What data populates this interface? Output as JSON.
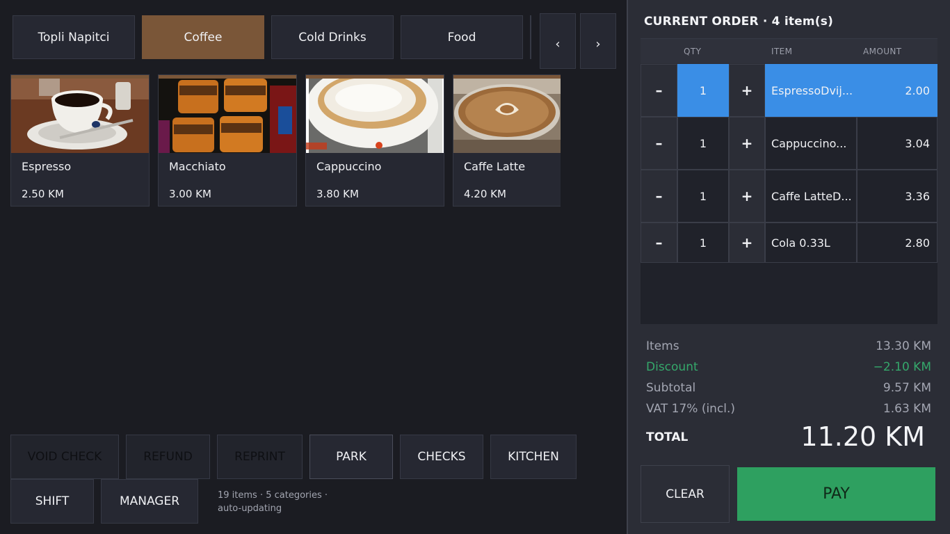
{
  "categories": [
    {
      "label": "Topli Napitci",
      "active": false
    },
    {
      "label": "Coffee",
      "active": true
    },
    {
      "label": "Cold Drinks",
      "active": false
    },
    {
      "label": "Food",
      "active": false
    }
  ],
  "nav": {
    "prev": "‹",
    "next": "›"
  },
  "products": [
    {
      "name": "Espresso",
      "price": "2.50 KM"
    },
    {
      "name": "Macchiato",
      "price": "3.00 KM"
    },
    {
      "name": "Cappuccino",
      "price": "3.80 KM"
    },
    {
      "name": "Caffe Latte",
      "price": "4.20 KM"
    }
  ],
  "actions": {
    "void_check": "VOID CHECK",
    "refund": "REFUND",
    "reprint": "REPRINT",
    "park": "PARK",
    "checks": "CHECKS",
    "kitchen": "KITCHEN",
    "shift": "SHIFT",
    "manager": "MANAGER"
  },
  "footnote": {
    "line1": "19 items · 5 categories ·",
    "line2": "auto-updating"
  },
  "order": {
    "title": "CURRENT ORDER · 4 item(s)",
    "headers": {
      "qty": "QTY",
      "item": "ITEM",
      "amount": "AMOUNT"
    },
    "minus": "–",
    "plus": "+",
    "rows": [
      {
        "qty": "1",
        "item": "EspressoDvij...",
        "amount": "2.00",
        "selected": true
      },
      {
        "qty": "1",
        "item": "Cappuccino...",
        "amount": "3.04",
        "selected": false
      },
      {
        "qty": "1",
        "item": "Caffe LatteD...",
        "amount": "3.36",
        "selected": false
      },
      {
        "qty": "1",
        "item": "Cola 0.33L",
        "amount": "2.80",
        "selected": false
      }
    ]
  },
  "summary": {
    "items_label": "Items",
    "items_value": "13.30 KM",
    "discount_label": "Discount",
    "discount_value": "−2.10 KM",
    "subtotal_label": "Subtotal",
    "subtotal_value": "9.57 KM",
    "vat_label": "VAT 17% (incl.)",
    "vat_value": "1.63 KM",
    "total_label": "TOTAL",
    "total_value": "11.20 KM"
  },
  "buttons": {
    "clear": "CLEAR",
    "pay": "PAY"
  },
  "colors": {
    "accent_coffee": "#7a5638",
    "selected_row": "#3a8ee6",
    "pay_green": "#2ea060",
    "discount_green": "#35a86b"
  }
}
